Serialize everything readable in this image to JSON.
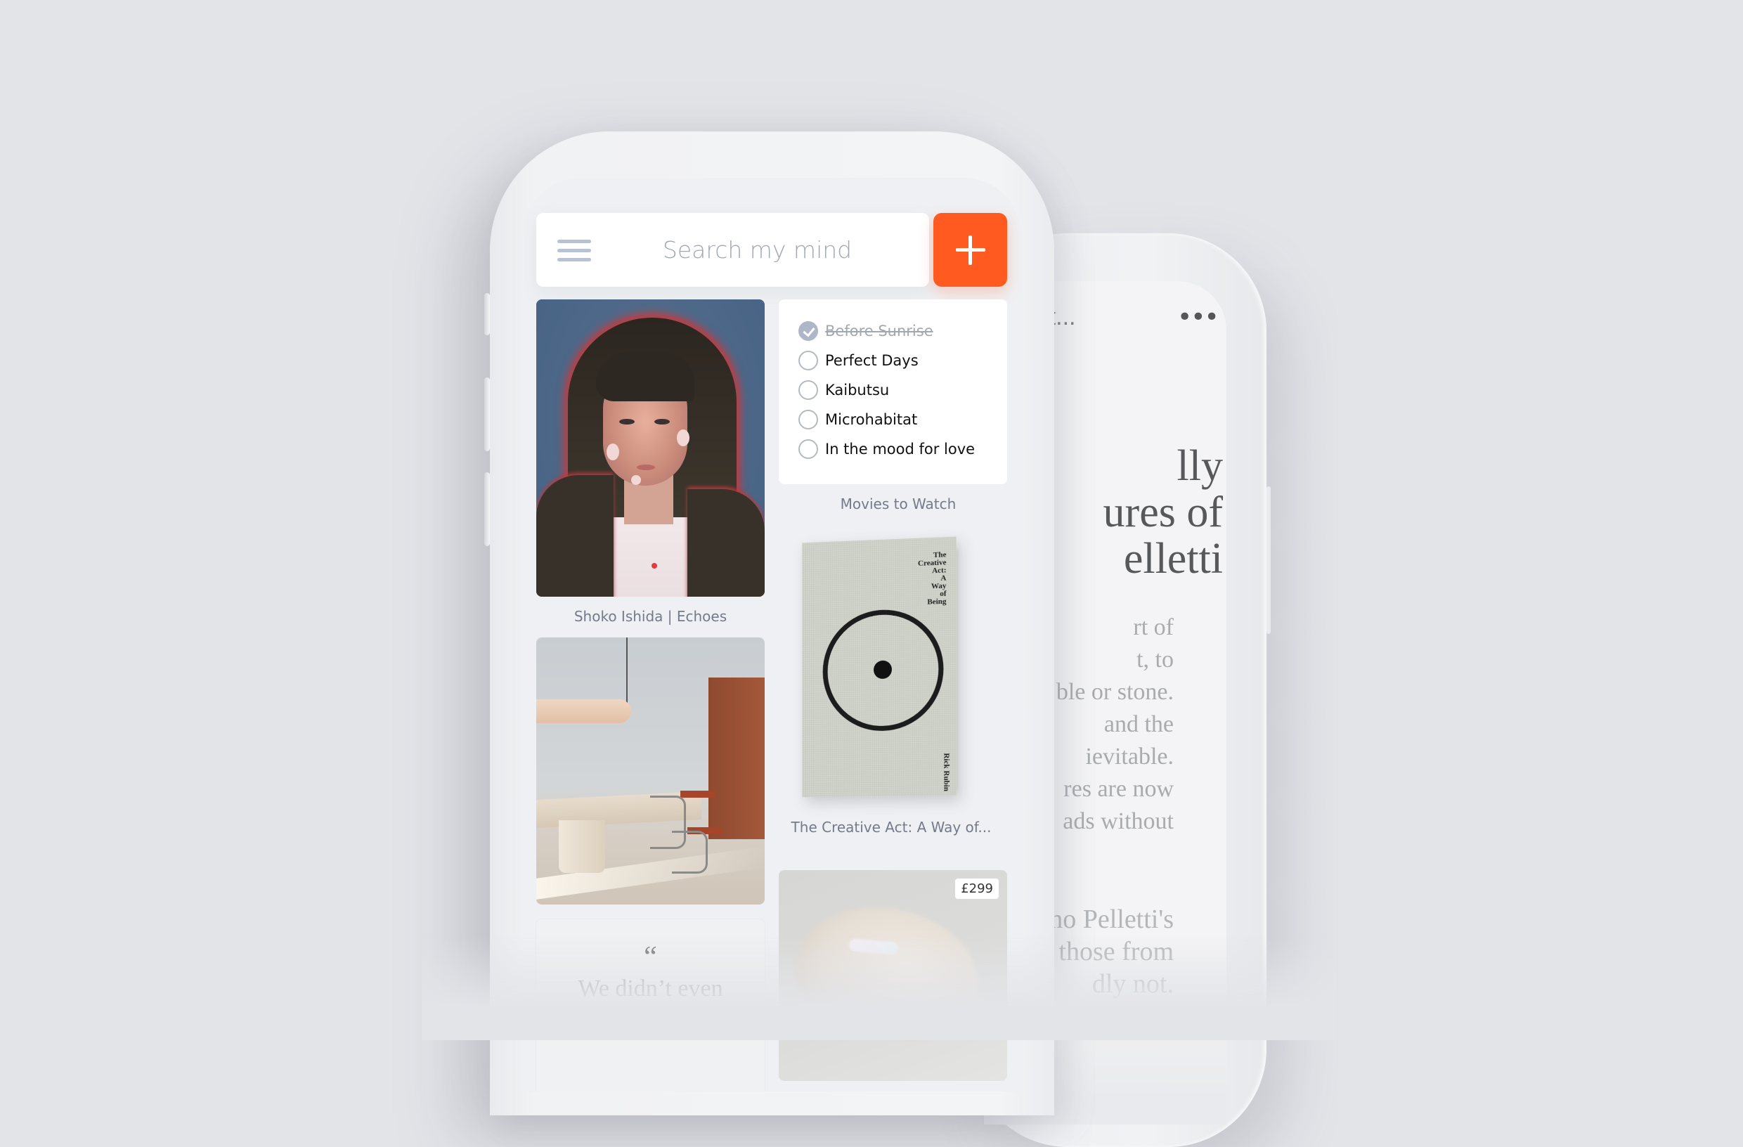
{
  "search": {
    "placeholder": "Search my mind",
    "menu_icon": "hamburger-menu-icon",
    "add_button_icon": "plus-icon",
    "accent_color": "#ff5b21"
  },
  "cards": {
    "artwork": {
      "caption": "Shoko Ishida | Echoes"
    },
    "checklist": {
      "title": "Movies to Watch",
      "items": [
        {
          "label": "Before Sunrise",
          "done": true
        },
        {
          "label": "Perfect Days",
          "done": false
        },
        {
          "label": "Kaibutsu",
          "done": false
        },
        {
          "label": "Microhabitat",
          "done": false
        },
        {
          "label": "In the mood for love",
          "done": false
        }
      ]
    },
    "book": {
      "cover_title": "The\nCreative\nAct:\nA\nWay\nof\nBeing",
      "cover_author": "Rick Rubin",
      "caption": "The Creative Act: A Way of..."
    },
    "interior": {},
    "quote": {
      "mark": "“",
      "text": "We didn’t even"
    },
    "product": {
      "price": "£299"
    }
  },
  "detail_phone": {
    "header_title": "rfect...",
    "more_icon": "more-horizontal-icon",
    "more_label": "•••",
    "headline_lines": [
      "lly",
      "ures of",
      "elletti"
    ],
    "body_lines": [
      "rt of",
      "t, to",
      "ble or stone.",
      " and the",
      "ievitable.",
      "res are now",
      "ads without"
    ],
    "body2_lines": [
      "no Pelletti's",
      ": those from",
      "dly not."
    ]
  }
}
